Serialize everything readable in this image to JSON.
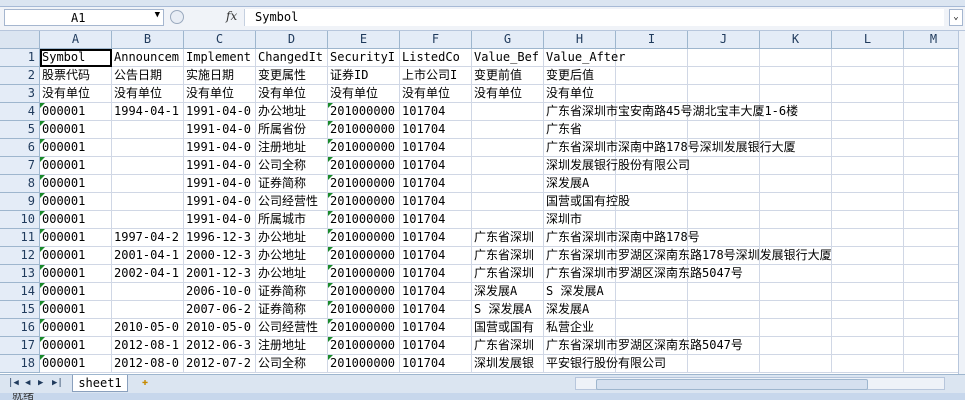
{
  "formula_bar": {
    "name_box": "A1",
    "fx_label": "fx",
    "formula": "Symbol"
  },
  "columns": [
    "A",
    "B",
    "C",
    "D",
    "E",
    "F",
    "G",
    "H",
    "I",
    "J",
    "K",
    "L",
    "M"
  ],
  "rows": [
    {
      "n": "1",
      "c": [
        "Symbol",
        "Announcem",
        "Implement",
        "ChangedIt",
        "SecurityI",
        "ListedCo",
        "Value_Bef",
        "Value_After"
      ]
    },
    {
      "n": "2",
      "c": [
        "股票代码",
        "公告日期",
        "实施日期",
        "变更属性",
        "证券ID",
        "上市公司I",
        "变更前值",
        "变更后值"
      ]
    },
    {
      "n": "3",
      "c": [
        "没有单位",
        "没有单位",
        "没有单位",
        "没有单位",
        "没有单位",
        "没有单位",
        "没有单位",
        "没有单位"
      ]
    },
    {
      "n": "4",
      "c": [
        "000001",
        "1994-04-1",
        "1991-04-0",
        "办公地址",
        "201000000",
        "101704",
        "",
        "广东省深圳市宝安南路45号湖北宝丰大厦1-6楼"
      ]
    },
    {
      "n": "5",
      "c": [
        "000001",
        "",
        "1991-04-0",
        "所属省份",
        "201000000",
        "101704",
        "",
        "广东省"
      ]
    },
    {
      "n": "6",
      "c": [
        "000001",
        "",
        "1991-04-0",
        "注册地址",
        "201000000",
        "101704",
        "",
        "广东省深圳市深南中路178号深圳发展银行大厦"
      ]
    },
    {
      "n": "7",
      "c": [
        "000001",
        "",
        "1991-04-0",
        "公司全称",
        "201000000",
        "101704",
        "",
        "深圳发展银行股份有限公司"
      ]
    },
    {
      "n": "8",
      "c": [
        "000001",
        "",
        "1991-04-0",
        "证券简称",
        "201000000",
        "101704",
        "",
        "深发展A"
      ]
    },
    {
      "n": "9",
      "c": [
        "000001",
        "",
        "1991-04-0",
        "公司经营性",
        "201000000",
        "101704",
        "",
        "国营或国有控股"
      ]
    },
    {
      "n": "10",
      "c": [
        "000001",
        "",
        "1991-04-0",
        "所属城市",
        "201000000",
        "101704",
        "",
        "深圳市"
      ]
    },
    {
      "n": "11",
      "c": [
        "000001",
        "1997-04-2",
        "1996-12-3",
        "办公地址",
        "201000000",
        "101704",
        "广东省深圳",
        "广东省深圳市深南中路178号"
      ]
    },
    {
      "n": "12",
      "c": [
        "000001",
        "2001-04-1",
        "2000-12-3",
        "办公地址",
        "201000000",
        "101704",
        "广东省深圳",
        "广东省深圳市罗湖区深南东路178号深圳发展银行大厦"
      ]
    },
    {
      "n": "13",
      "c": [
        "000001",
        "2002-04-1",
        "2001-12-3",
        "办公地址",
        "201000000",
        "101704",
        "广东省深圳",
        "广东省深圳市罗湖区深南东路5047号"
      ]
    },
    {
      "n": "14",
      "c": [
        "000001",
        "",
        "2006-10-0",
        "证券简称",
        "201000000",
        "101704",
        "深发展A",
        "S 深发展A"
      ]
    },
    {
      "n": "15",
      "c": [
        "000001",
        "",
        "2007-06-2",
        "证券简称",
        "201000000",
        "101704",
        "S 深发展A",
        "深发展A"
      ]
    },
    {
      "n": "16",
      "c": [
        "000001",
        "2010-05-0",
        "2010-05-0",
        "公司经营性",
        "201000000",
        "101704",
        "国营或国有",
        "私营企业"
      ]
    },
    {
      "n": "17",
      "c": [
        "000001",
        "2012-08-1",
        "2012-06-3",
        "注册地址",
        "201000000",
        "101704",
        "广东省深圳",
        "广东省深圳市罗湖区深南东路5047号"
      ]
    },
    {
      "n": "18",
      "c": [
        "000001",
        "2012-08-0",
        "2012-07-2",
        "公司全称",
        "201000000",
        "101704",
        "深圳发展银",
        "平安银行股份有限公司"
      ]
    }
  ],
  "sheet_tabs": [
    "sheet1"
  ],
  "status_text": "就绪"
}
